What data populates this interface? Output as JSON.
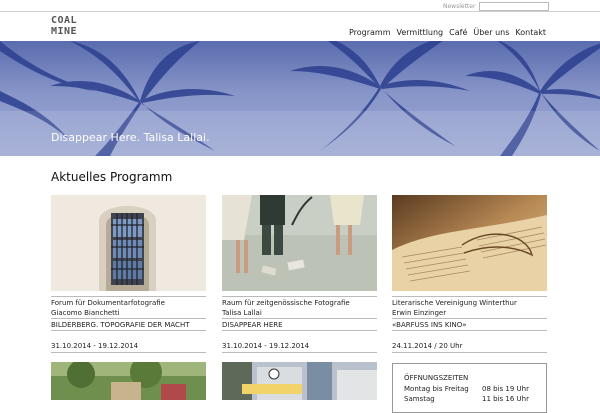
{
  "header": {
    "newsletter_label": "Newsletter",
    "newsletter_placeholder": "",
    "logo_line1": "COAL",
    "logo_line2": "MINE",
    "nav": [
      "Programm",
      "Vermittlung",
      "Café",
      "Über uns",
      "Kontakt"
    ]
  },
  "hero": {
    "caption": "Disappear Here. Talisa Lallai."
  },
  "main": {
    "section_title": "Aktuelles Programm",
    "cards": [
      {
        "venue": "Forum für Dokumentarfotografie",
        "artist": "Giacomo Bianchetti",
        "title": "BILDERBERG. TOPOGRAFIE DER MACHT",
        "date": "31.10.2014 - 19.12.2014"
      },
      {
        "venue": "Raum für zeitgenössische Fotografie",
        "artist": "Talisa Lallai",
        "title": "DISAPPEAR HERE",
        "date": "31.10.2014 - 19.12.2014"
      },
      {
        "venue": "Literarische Vereinigung Winterthur",
        "artist": "Erwin Einzinger",
        "title": "«BARFUSS INS KINO»",
        "date": "24.11.2014 / 20 Uhr"
      }
    ],
    "hours": {
      "title": "ÖFFNUNGSZEITEN",
      "rows": [
        {
          "day": "Montag bis Freitag",
          "time": "08 bis 19 Uhr"
        },
        {
          "day": "Samstag",
          "time": "11 bis 16 Uhr"
        }
      ]
    }
  },
  "colors": {
    "hero_blue": "#5a6cae",
    "rule_grey": "#bbbbbb"
  }
}
